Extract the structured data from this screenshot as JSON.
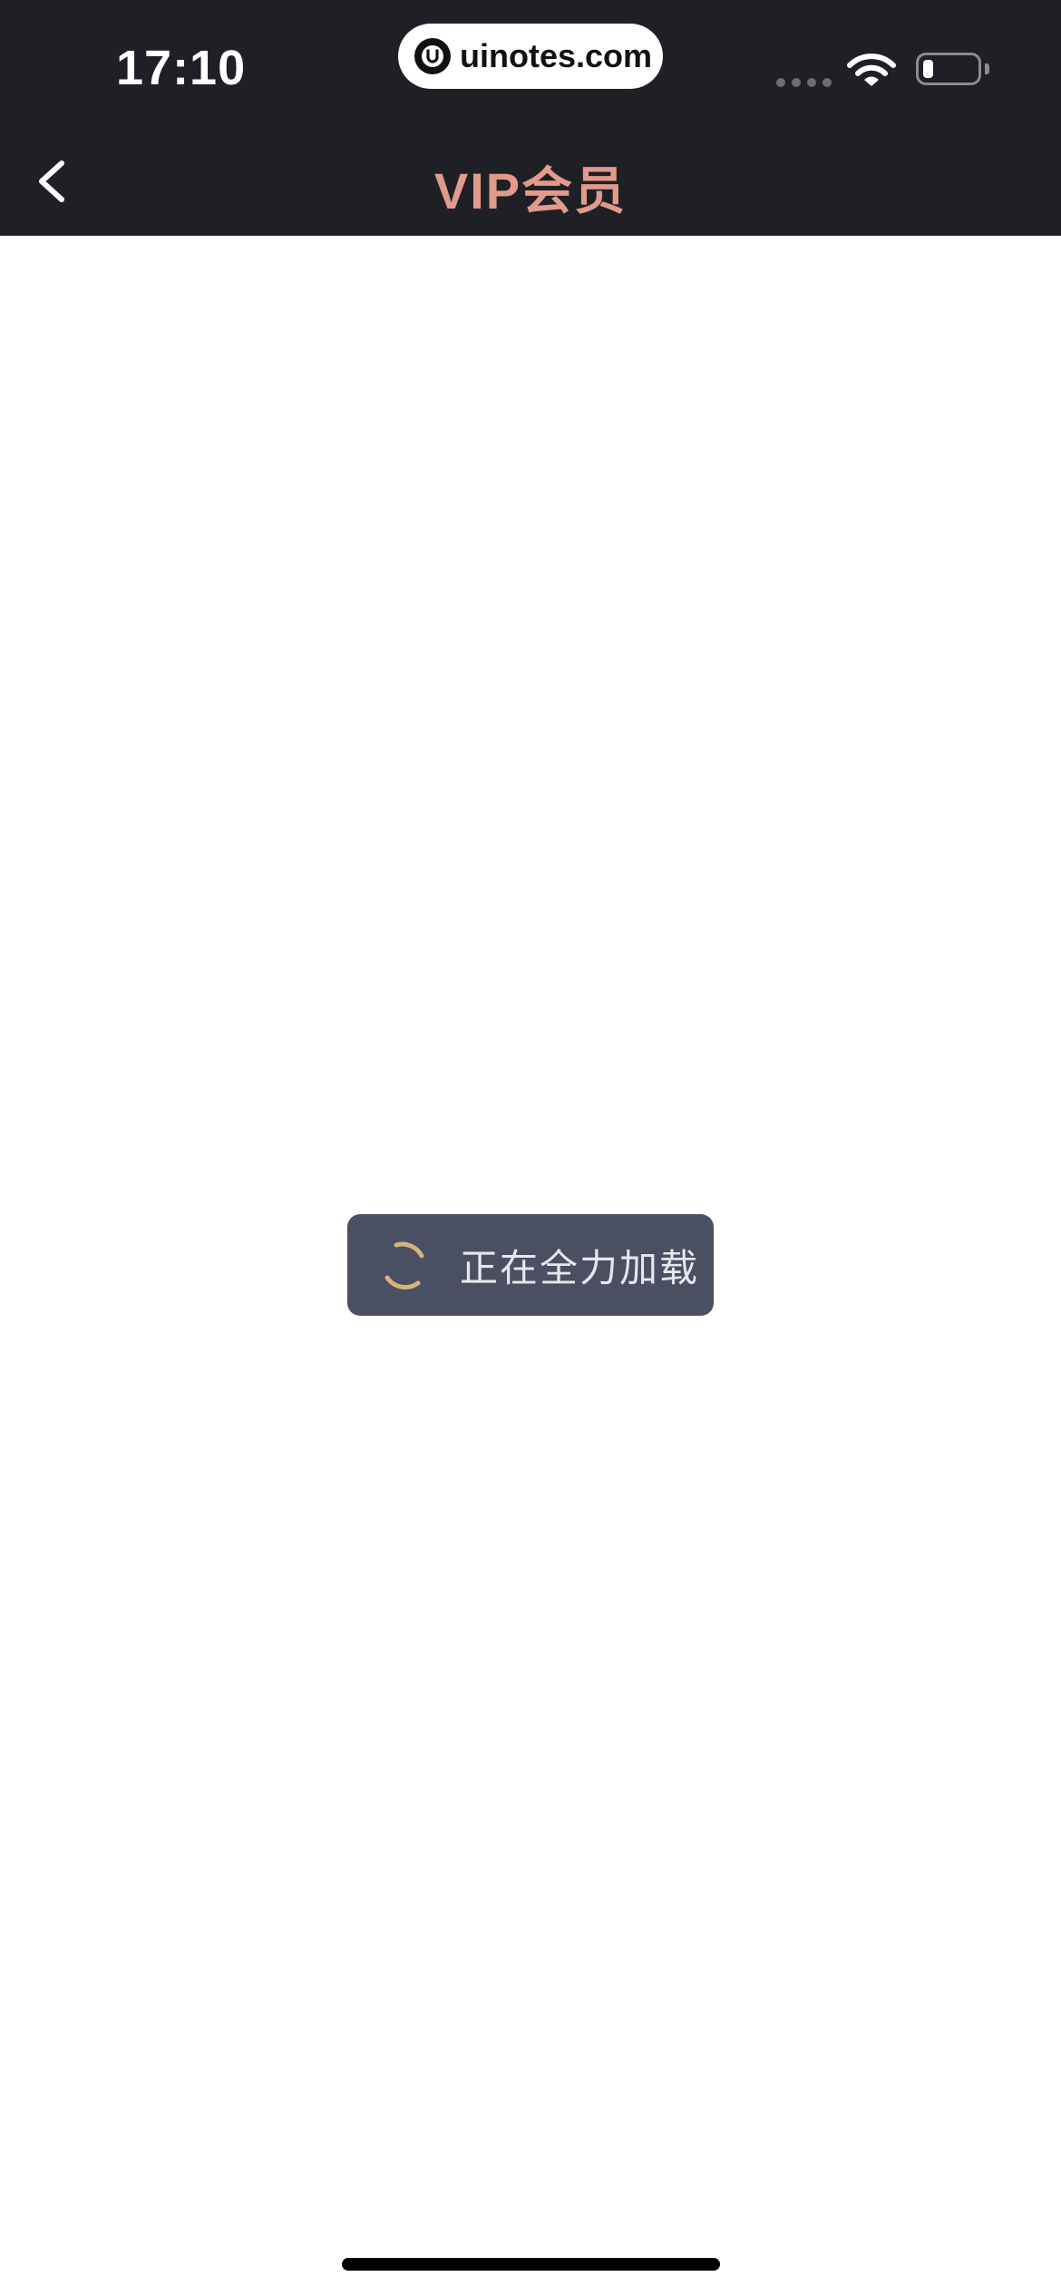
{
  "status_bar": {
    "time": "17:10",
    "url": "uinotes.com",
    "logo_letter": "U"
  },
  "nav": {
    "title": "VIP会员",
    "title_color": "#e19a8c",
    "back_icon": "chevron-left-icon"
  },
  "loading": {
    "text": "正在全力加载",
    "spinner_color": "#d8b27e"
  },
  "colors": {
    "header_bg": "#1f2025",
    "toast_bg": "#4a4f62",
    "page_bg": "#ffffff"
  }
}
